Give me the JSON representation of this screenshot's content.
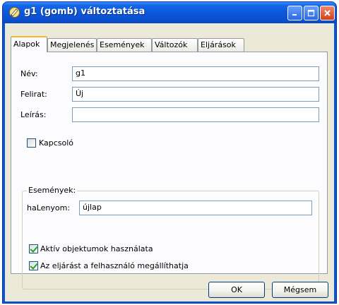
{
  "window": {
    "title": "g1 (gomb) változtatása",
    "icon": "pencil-icon"
  },
  "tabs": [
    {
      "label": "Alapok",
      "active": true
    },
    {
      "label": "Megjelenés",
      "active": false
    },
    {
      "label": "Események",
      "active": false
    },
    {
      "label": "Változók",
      "active": false
    },
    {
      "label": "Eljárások",
      "active": false
    }
  ],
  "form": {
    "nev": {
      "label": "Név:",
      "value": "g1"
    },
    "felirat": {
      "label": "Felirat:",
      "value": "Új"
    },
    "leiras": {
      "label": "Leírás:",
      "value": ""
    },
    "kapcsolo": {
      "label": "Kapcsoló",
      "checked": false
    }
  },
  "events_group": {
    "title": "Események:",
    "halenyom": {
      "label": "haLenyom:",
      "value": "újlap"
    },
    "aktiv": {
      "label": "Aktív objektumok használata",
      "checked": true
    },
    "megallithatja": {
      "label": "Az eljárást a felhasználó megállíthatja",
      "checked": true
    }
  },
  "buttons": {
    "ok": "OK",
    "cancel": "Mégsem"
  },
  "colors": {
    "titlebar": "#0b56d6",
    "client": "#ece9d8",
    "close": "#d2401d",
    "active_tab_accent": "#f4b830"
  }
}
